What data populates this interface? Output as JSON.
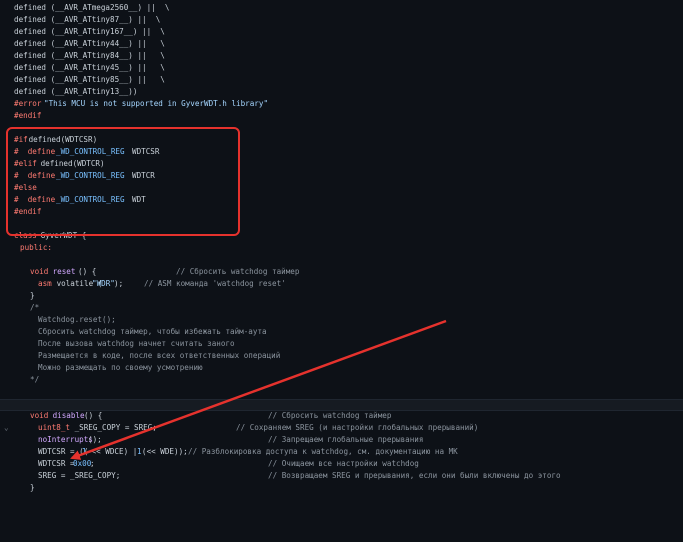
{
  "lines": {
    "l1": "defined (__AVR_ATmega2560__) ||  \\",
    "l2": "defined (__AVR_ATtiny87__) ||  \\",
    "l3": "defined (__AVR_ATtiny167__) ||  \\",
    "l4": "defined (__AVR_ATtiny44__) ||   \\",
    "l5": "defined (__AVR_ATtiny84__) ||   \\",
    "l6": "defined (__AVR_ATtiny45__) ||   \\",
    "l7": "defined (__AVR_ATtiny85__) ||   \\",
    "l8": "defined (__AVR_ATtiny13__))",
    "l9_kw": "#error",
    "l9_str": "\"This MCU is not supported in GyverWDT.h library\"",
    "l10": "#endif",
    "l12_kw": "#if",
    "l12_rest": " defined(WDTCSR)",
    "l13_kw": "#  define",
    "l13_name": "_WD_CONTROL_REG",
    "l13_val": "WDTCSR",
    "l14_kw": "#elif",
    "l14_rest": " defined(WDTCR)",
    "l15_kw": "#  define",
    "l15_name": "_WD_CONTROL_REG",
    "l15_val": "WDTCR",
    "l16": "#else",
    "l17_kw": "#  define",
    "l17_name": "_WD_CONTROL_REG",
    "l17_val": "WDT",
    "l18": "#endif",
    "l20_kw": "class",
    "l20_rest": " GyverWDT {",
    "l21": "public:",
    "l23_type": "void",
    "l23_fn": " reset",
    "l23_rest": "() {",
    "l23_cm": "// Сбросить watchdog таймер",
    "l24_kw": "asm",
    "l24_rest": " volatile (",
    "l24_str": "\"WDR\"",
    "l24_end": ");",
    "l24_cm": "// ASM команда 'watchdog reset'",
    "l25": "}",
    "l26": "/*",
    "l27": "Watchdog.reset();",
    "l28": "Сбросить watchdog таймер, чтобы избежать тайм-аута",
    "l29": "После вызова watchdog начнет считать заного",
    "l30": "Размещается в коде, после всех ответственных операций",
    "l31": "Можно размещать по своему усмотрению",
    "l32": "*/",
    "l34_gutter": "⌄",
    "l34_type": "void",
    "l34_fn": " disable",
    "l34_rest": "() {",
    "l34_cm": "// Сбросить watchdog таймер",
    "l35_type": "uint8_t",
    "l35_rest": " _SREG_COPY = SREG;",
    "l35_cm": "// Сохраняем SREG (и настройки глобальных прерываний)",
    "l36_fn": "noInterrupts",
    "l36_rest": "();",
    "l36_cm": "// Запрещаем глобальные прерывания",
    "l37_a": "WDTCSR = ((",
    "l37_n1": "1",
    "l37_b": " << WDCE) | (",
    "l37_n2": "1",
    "l37_c": " << WDE));",
    "l37_cm": "// Разблокировка доступа к watchdog, см. документацию на МК",
    "l38_a": "WDTCSR = ",
    "l38_n": "0x00",
    "l38_b": ";",
    "l38_cm": "// Очищаем все настройки watchdog",
    "l39": "SREG = _SREG_COPY;",
    "l39_cm": "// Возвращаем SREG и прерывания, если они были включены до этого",
    "l40": "}"
  },
  "colors": {
    "background": "#0d1117",
    "keyword": "#ff7b72",
    "string": "#a5d6ff",
    "comment": "#8b949e",
    "function": "#d2a8ff",
    "annotation_red": "#e5322d"
  }
}
